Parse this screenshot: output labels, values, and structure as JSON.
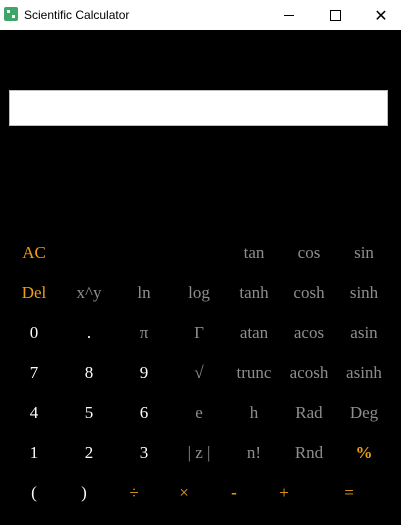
{
  "window": {
    "title": "Scientific Calculator",
    "minimize_glyph": "",
    "close_glyph": "✕"
  },
  "display": {
    "value": ""
  },
  "colors": {
    "orange": "#ee9f15",
    "gray": "#8e8e8e",
    "white": "#ffffff",
    "background": "#000000"
  },
  "rows": [
    {
      "keys": [
        {
          "label": "AC",
          "style": "orange",
          "name": "clear-all-button"
        },
        {
          "label": "tan",
          "style": "gray",
          "name": "tan-button"
        },
        {
          "label": "cos",
          "style": "gray",
          "name": "cos-button"
        },
        {
          "label": "sin",
          "style": "gray",
          "name": "sin-button"
        }
      ]
    },
    {
      "keys": [
        {
          "label": "Del",
          "style": "orange",
          "name": "delete-button"
        },
        {
          "label": "x^y",
          "style": "gray",
          "name": "power-button"
        },
        {
          "label": "ln",
          "style": "gray",
          "name": "ln-button"
        },
        {
          "label": "log",
          "style": "gray",
          "name": "log-button"
        },
        {
          "label": "tanh",
          "style": "gray",
          "name": "tanh-button"
        },
        {
          "label": "cosh",
          "style": "gray",
          "name": "cosh-button"
        },
        {
          "label": "sinh",
          "style": "gray",
          "name": "sinh-button"
        }
      ]
    },
    {
      "keys": [
        {
          "label": "0",
          "style": "white",
          "name": "digit-0-button"
        },
        {
          "label": ".",
          "style": "white",
          "name": "decimal-point-button"
        },
        {
          "label": "π",
          "style": "gray",
          "name": "pi-button"
        },
        {
          "label": "Γ",
          "style": "gray",
          "name": "gamma-button"
        },
        {
          "label": "atan",
          "style": "gray",
          "name": "atan-button"
        },
        {
          "label": "acos",
          "style": "gray",
          "name": "acos-button"
        },
        {
          "label": "asin",
          "style": "gray",
          "name": "asin-button"
        }
      ]
    },
    {
      "keys": [
        {
          "label": "7",
          "style": "white",
          "name": "digit-7-button"
        },
        {
          "label": "8",
          "style": "white",
          "name": "digit-8-button"
        },
        {
          "label": "9",
          "style": "white",
          "name": "digit-9-button"
        },
        {
          "label": "√",
          "style": "gray",
          "name": "sqrt-button"
        },
        {
          "label": "trunc",
          "style": "gray",
          "name": "trunc-button"
        },
        {
          "label": "acosh",
          "style": "gray",
          "name": "acosh-button"
        },
        {
          "label": "asinh",
          "style": "gray",
          "name": "asinh-button"
        }
      ]
    },
    {
      "keys": [
        {
          "label": "4",
          "style": "white",
          "name": "digit-4-button"
        },
        {
          "label": "5",
          "style": "white",
          "name": "digit-5-button"
        },
        {
          "label": "6",
          "style": "white",
          "name": "digit-6-button"
        },
        {
          "label": "e",
          "style": "gray",
          "name": "euler-button"
        },
        {
          "label": "h",
          "style": "gray",
          "name": "h-button"
        },
        {
          "label": "Rad",
          "style": "gray",
          "name": "radians-button"
        },
        {
          "label": "Deg",
          "style": "gray",
          "name": "degrees-button"
        }
      ]
    },
    {
      "keys": [
        {
          "label": "1",
          "style": "white",
          "name": "digit-1-button"
        },
        {
          "label": "2",
          "style": "white",
          "name": "digit-2-button"
        },
        {
          "label": "3",
          "style": "white",
          "name": "digit-3-button"
        },
        {
          "label": "| z |",
          "style": "gray",
          "name": "abs-button"
        },
        {
          "label": "n!",
          "style": "gray",
          "name": "factorial-button"
        },
        {
          "label": "Rnd",
          "style": "gray",
          "name": "random-button"
        },
        {
          "label": "%",
          "style": "orange bold",
          "name": "percent-button"
        }
      ]
    },
    {
      "keys": [
        {
          "label": "(",
          "style": "white",
          "name": "open-paren-button"
        },
        {
          "label": ")",
          "style": "white",
          "name": "close-paren-button"
        },
        {
          "label": "÷",
          "style": "orange",
          "name": "divide-button"
        },
        {
          "label": "×",
          "style": "orange",
          "name": "multiply-button"
        },
        {
          "label": "-",
          "style": "orange bold",
          "name": "subtract-button"
        },
        {
          "label": "+",
          "style": "orange",
          "name": "add-button"
        },
        {
          "label": "=",
          "style": "orange",
          "name": "equals-button"
        }
      ]
    }
  ]
}
